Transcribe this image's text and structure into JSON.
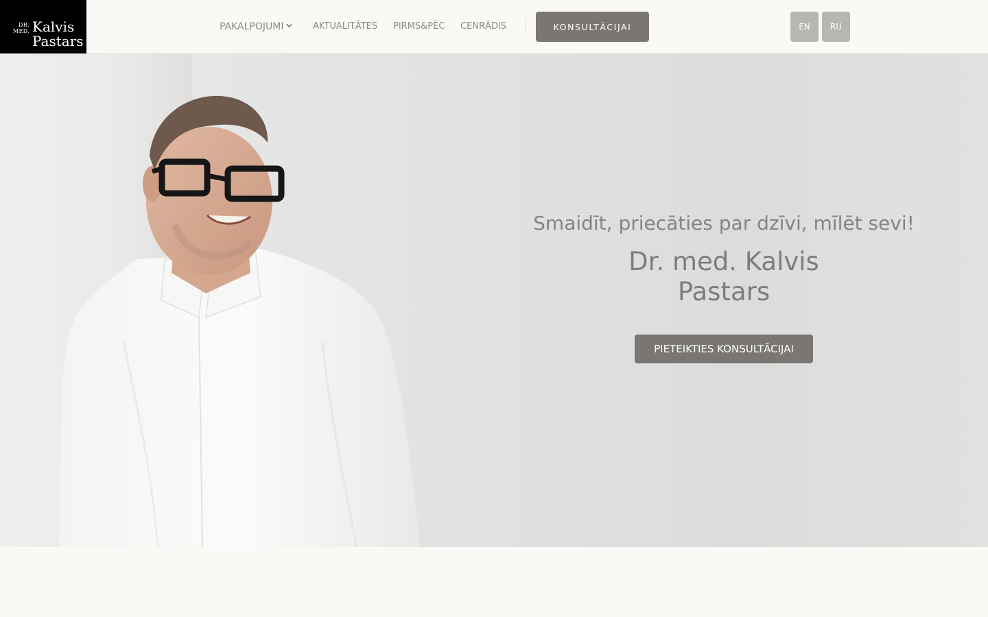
{
  "logo": {
    "prefix_line1": "DR.",
    "prefix_line2": "MED.",
    "name_line1": "Kalvis",
    "name_line2": "Pastars"
  },
  "nav": {
    "services": "PAKALPOJUMI",
    "news": "AKTUALITĀTES",
    "before_after": "PIRMS&PĒC",
    "prices": "CENRĀDIS",
    "consult_button": "KONSULTĀCIJAI"
  },
  "languages": [
    "EN",
    "RU"
  ],
  "hero": {
    "tagline": "Smaidīt, priecāties par dzīvi, mīlēt sevi!",
    "name_line1": "Dr. med. Kalvis",
    "name_line2": "Pastars",
    "cta": "PIETEIKTIES KONSULTĀCIJAI"
  },
  "colors": {
    "background": "#faf9f5",
    "logo_bg": "#000000",
    "button": "#7a7772",
    "lang_button": "#b8b6b1",
    "nav_text": "#8a8a88",
    "hero_text": "#858480"
  },
  "icons": {
    "dropdown": "chevron-down-icon"
  }
}
